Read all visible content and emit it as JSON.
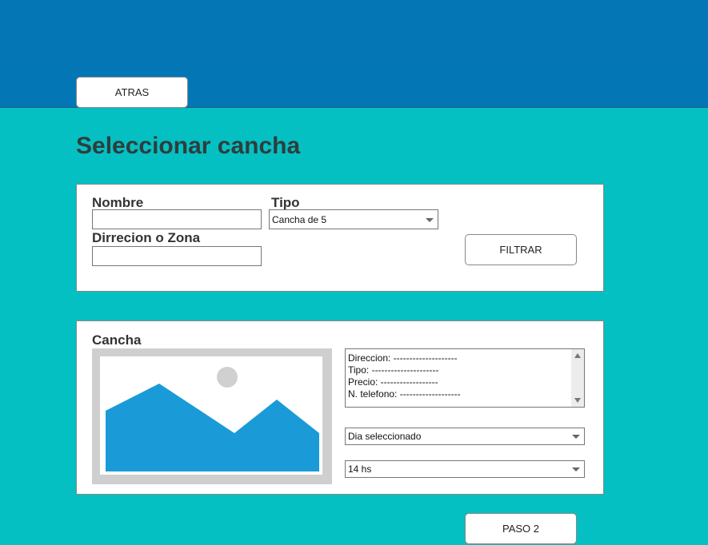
{
  "header": {
    "back_label": "ATRAS"
  },
  "page_title": "Seleccionar cancha",
  "filter_panel": {
    "name_label": "Nombre",
    "name_value": "",
    "type_label": "Tipo",
    "type_selected": "Cancha de 5",
    "address_label": "Dirrecion o Zona",
    "address_value": "",
    "filter_button_label": "FILTRAR"
  },
  "court_panel": {
    "title": "Cancha",
    "image_icon": "image-placeholder-icon",
    "details": [
      "Direccion: --------------------",
      "Tipo: ---------------------",
      "Precio: ------------------",
      "N. telefono: -------------------"
    ],
    "day_selected": "Dia seleccionado",
    "time_selected": "14 hs"
  },
  "footer": {
    "next_label": "PASO 2"
  },
  "colors": {
    "background": "#05c0c2",
    "header": "#0376b6",
    "image_fill": "#1a9bd7",
    "image_frame": "#cfcfcf"
  }
}
